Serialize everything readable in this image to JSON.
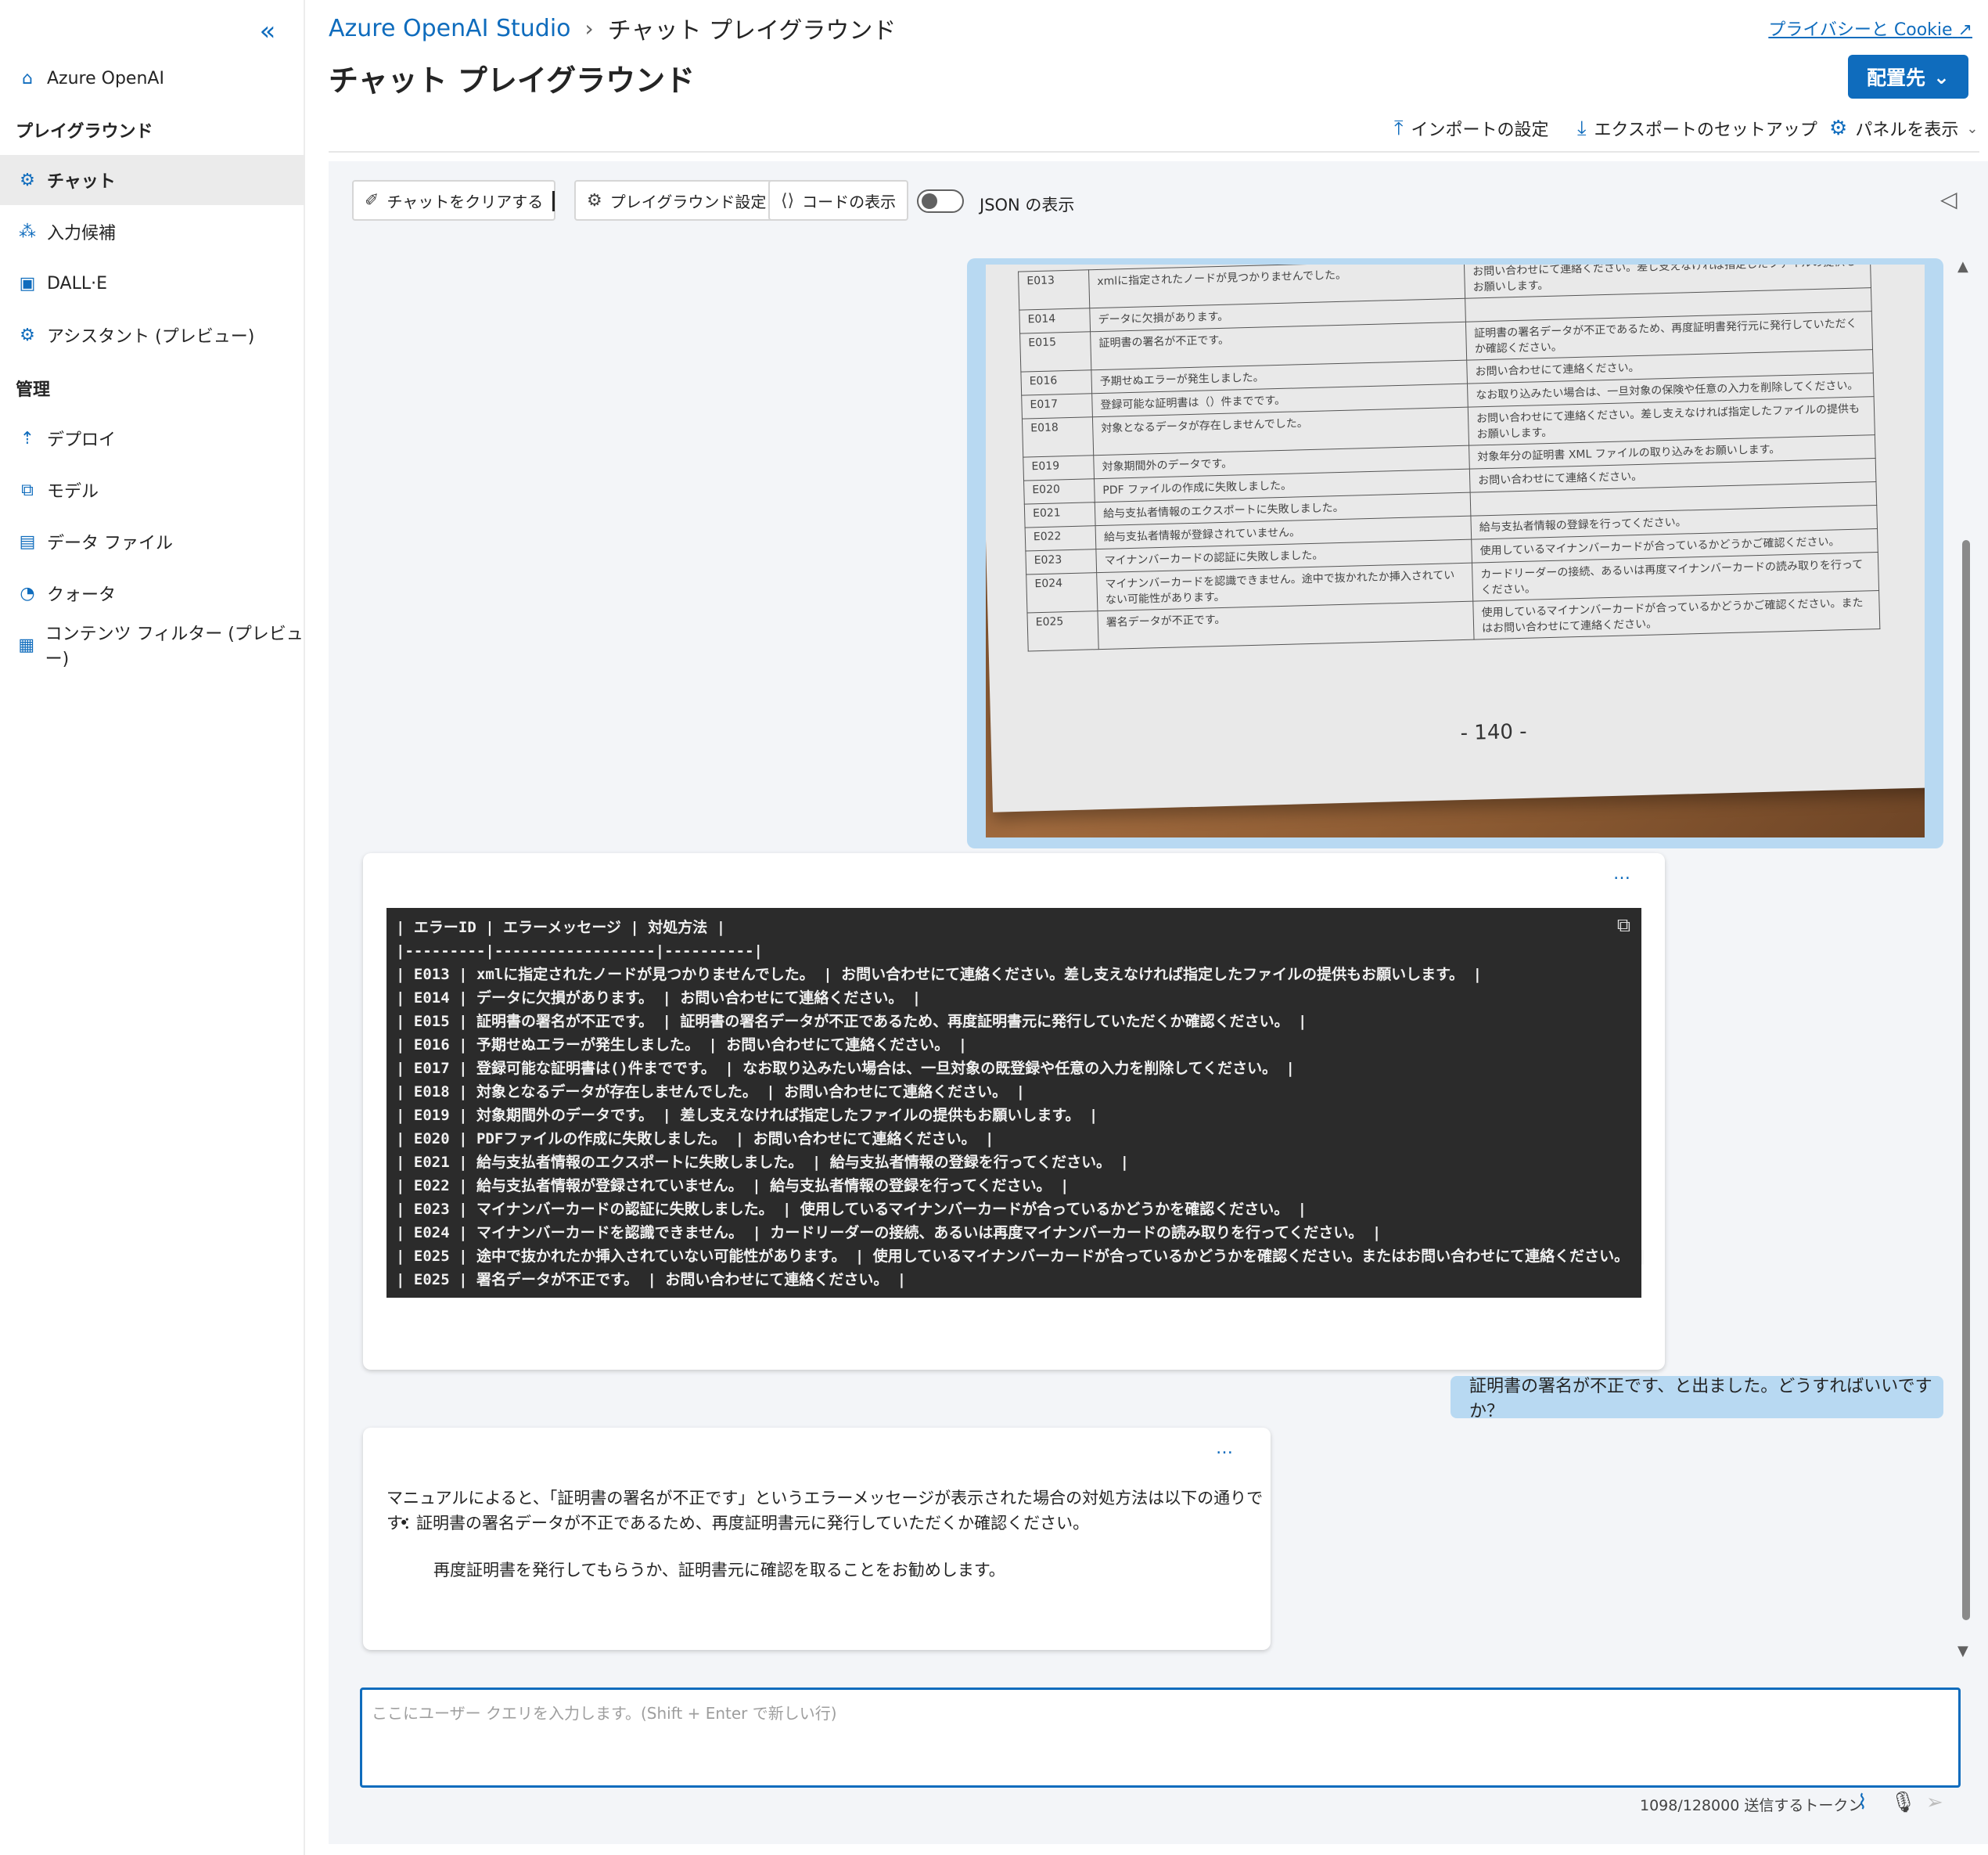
{
  "sidebar": {
    "collapse_icon": "double-chevron-left-icon",
    "home_label": "Azure OpenAI",
    "section_playground": "プレイグラウンド",
    "items_playground": [
      {
        "label": "チャット",
        "icon": "chat-bot-icon",
        "active": true
      },
      {
        "label": "入力候補",
        "icon": "completions-icon"
      },
      {
        "label": "DALL·E",
        "icon": "image-icon"
      },
      {
        "label": "アシスタント (プレビュー)",
        "icon": "assistant-icon"
      }
    ],
    "section_manage": "管理",
    "items_manage": [
      {
        "label": "デプロイ",
        "icon": "deploy-icon"
      },
      {
        "label": "モデル",
        "icon": "model-icon"
      },
      {
        "label": "データ ファイル",
        "icon": "data-file-icon"
      },
      {
        "label": "クォータ",
        "icon": "quota-icon"
      },
      {
        "label": "コンテンツ フィルター (プレビュー)",
        "icon": "content-filter-icon"
      }
    ]
  },
  "header": {
    "breadcrumb_root": "Azure OpenAI Studio",
    "breadcrumb_current": "チャット プレイグラウンド",
    "title": "チャット プレイグラウンド",
    "privacy_link": "プライバシーと Cookie",
    "deploy_button": "配置先",
    "import_label": "インポートの設定",
    "export_label": "エクスポートのセットアップ",
    "panel_label": "パネルを表示"
  },
  "toolbar": {
    "clear_chat": "チャットをクリアする",
    "playground_settings": "プレイグラウンド設定",
    "view_code": "コードの表示",
    "json_toggle_label": "JSON の表示",
    "json_toggle_on": false
  },
  "image_message": {
    "paper_rows": [
      {
        "id": "E013",
        "msg": "xmlに指定されたノードが見つかりませんでした。",
        "fix": "お問い合わせにて連絡ください。差し支えなければ指定したファイルの提供もお願いします。"
      },
      {
        "id": "E014",
        "msg": "データに欠損があります。",
        "fix": ""
      },
      {
        "id": "E015",
        "msg": "証明書の署名が不正です。",
        "fix": "証明書の署名データが不正であるため、再度証明書発行元に発行していただくか確認ください。"
      },
      {
        "id": "E016",
        "msg": "予期せぬエラーが発生しました。",
        "fix": "お問い合わせにて連絡ください。"
      },
      {
        "id": "E017",
        "msg": "登録可能な証明書は（）件までです。",
        "fix": "なお取り込みたい場合は、一旦対象の保険や任意の入力を削除してください。"
      },
      {
        "id": "E018",
        "msg": "対象となるデータが存在しませんでした。",
        "fix": "お問い合わせにて連絡ください。差し支えなければ指定したファイルの提供もお願いします。"
      },
      {
        "id": "E019",
        "msg": "対象期間外のデータです。",
        "fix": "対象年分の証明書 XML ファイルの取り込みをお願いします。"
      },
      {
        "id": "E020",
        "msg": "PDF ファイルの作成に失敗しました。",
        "fix": "お問い合わせにて連絡ください。"
      },
      {
        "id": "E021",
        "msg": "給与支払者情報のエクスポートに失敗しました。",
        "fix": ""
      },
      {
        "id": "E022",
        "msg": "給与支払者情報が登録されていません。",
        "fix": "給与支払者情報の登録を行ってください。"
      },
      {
        "id": "E023",
        "msg": "マイナンバーカードの認証に失敗しました。",
        "fix": "使用しているマイナンバーカードが合っているかどうかご確認ください。"
      },
      {
        "id": "E024",
        "msg": "マイナンバーカードを認識できません。途中で抜かれたか挿入されていない可能性があります。",
        "fix": "カードリーダーの接続、あるいは再度マイナンバーカードの読み取りを行ってください。"
      },
      {
        "id": "E025",
        "msg": "署名データが不正です。",
        "fix": "使用しているマイナンバーカードが合っているかどうかご確認ください。またはお問い合わせにて連絡ください。"
      }
    ],
    "page_number": "- 140 -"
  },
  "assistant_1": {
    "more_icon": "more-horizontal-icon",
    "copy_icon": "copy-icon",
    "code_lines": [
      "| エラーID | エラーメッセージ | 対処方法 |",
      "|---------|------------------|----------|",
      "| E013 | xmlに指定されたノードが見つかりませんでした。 | お問い合わせにて連絡ください。差し支えなければ指定したファイルの提供もお願いします。 |",
      "| E014 | データに欠損があります。 | お問い合わせにて連絡ください。 |",
      "| E015 | 証明書の署名が不正です。 | 証明書の署名データが不正であるため、再度証明書元に発行していただくか確認ください。 |",
      "| E016 | 予期せぬエラーが発生しました。 | お問い合わせにて連絡ください。 |",
      "| E017 | 登録可能な証明書は()件までです。 | なお取り込みたい場合は、一旦対象の既登録や任意の入力を削除してください。 |",
      "| E018 | 対象となるデータが存在しませんでした。 | お問い合わせにて連絡ください。 |",
      "| E019 | 対象期間外のデータです。 | 差し支えなければ指定したファイルの提供もお願いします。 |",
      "| E020 | PDFファイルの作成に失敗しました。 | お問い合わせにて連絡ください。 |",
      "| E021 | 給与支払者情報のエクスポートに失敗しました。 | 給与支払者情報の登録を行ってください。 |",
      "| E022 | 給与支払者情報が登録されていません。 | 給与支払者情報の登録を行ってください。 |",
      "| E023 | マイナンバーカードの認証に失敗しました。 | 使用しているマイナンバーカードが合っているかどうかを確認ください。 |",
      "| E024 | マイナンバーカードを認識できません。 | カードリーダーの接続、あるいは再度マイナンバーカードの読み取りを行ってください。 |",
      "| E025 | 途中で抜かれたか挿入されていない可能性があります。 | 使用しているマイナンバーカードが合っているかどうかを確認ください。またはお問い合わせにて連絡ください。 |",
      "| E025 | 署名データが不正です。 | お問い合わせにて連絡ください。 |"
    ]
  },
  "user_message": {
    "text": "証明書の署名が不正です、と出ました。どうすればいいですか？"
  },
  "assistant_2": {
    "intro": "マニュアルによると、「証明書の署名が不正です」というエラーメッセージが表示された場合の対処方法は以下の通りです：",
    "bullet": "証明書の署名データが不正であるため、再度証明書元に発行していただくか確認ください。",
    "followup": "再度証明書を発行してもらうか、証明書元に確認を取ることをお勧めします。"
  },
  "input": {
    "placeholder": "ここにユーザー クエリを入力します。(Shift + Enter で新しい行)",
    "value": "",
    "token_counter": "1098/128000 送信するトークン"
  },
  "colors": {
    "accent": "#0f6cbd",
    "user_bubble": "#b8d9f2",
    "panel_bg": "#f3f5f8",
    "code_bg": "#2b2b2b"
  }
}
